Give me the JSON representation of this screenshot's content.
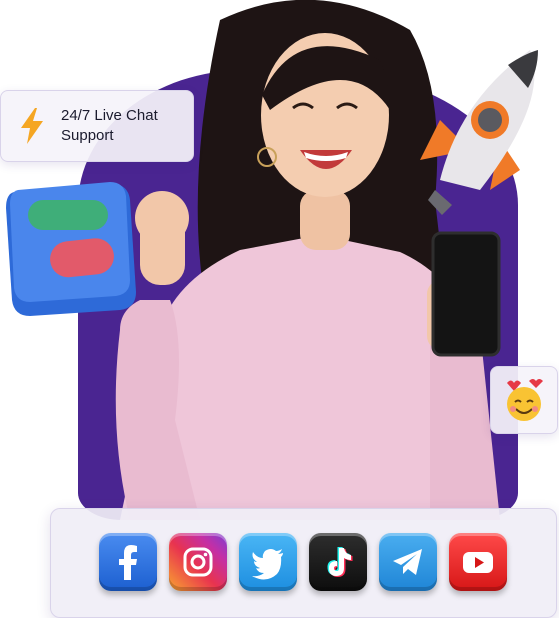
{
  "chat_card": {
    "line1": "24/7 Live Chat",
    "line2": "Support",
    "icon": "lightning-bolt-icon"
  },
  "decorations": {
    "toggle_tile_icon": "toggle-switch-icon",
    "rocket_icon": "rocket-icon",
    "emoji_icon": "smiling-face-with-hearts-icon"
  },
  "social_bar": {
    "icons": [
      "facebook-icon",
      "instagram-icon",
      "twitter-icon",
      "tiktok-icon",
      "telegram-icon",
      "youtube-icon"
    ]
  },
  "colors": {
    "background_blob": "#4a2591",
    "bolt": "#f5a623",
    "card_background": "#f5f3fa"
  }
}
